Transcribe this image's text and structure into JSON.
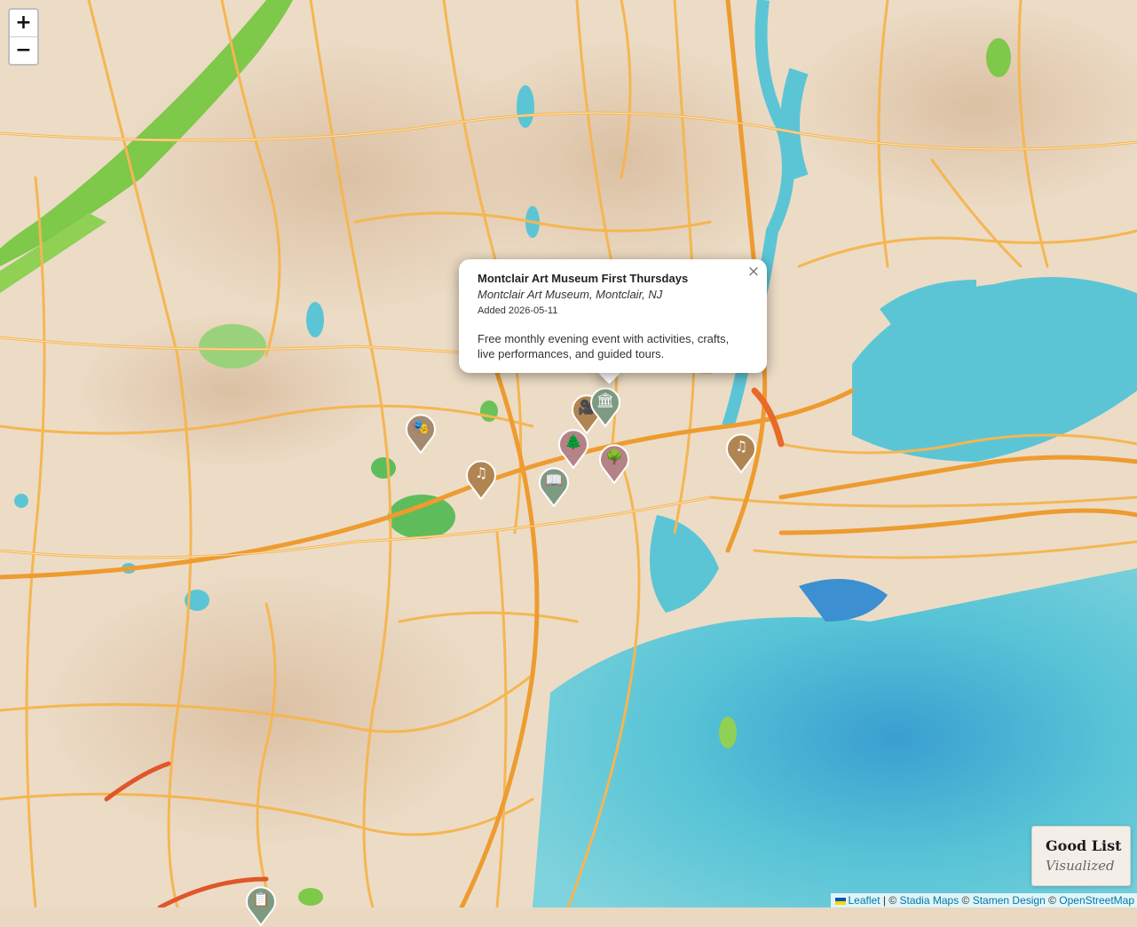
{
  "map": {
    "zoom_in_label": "+",
    "zoom_out_label": "−",
    "markers": [
      {
        "icon": "theater-masks-icon",
        "glyph": "🎭",
        "color": "#a48a6e"
      },
      {
        "icon": "music-note-icon",
        "glyph": "♫",
        "color": "#b08552"
      },
      {
        "icon": "book-icon",
        "glyph": "📖",
        "color": "#7f9a82"
      },
      {
        "icon": "tree-icon",
        "glyph": "🌲",
        "color": "#b48388"
      },
      {
        "icon": "video-camera-icon",
        "glyph": "🎥",
        "color": "#b08552"
      },
      {
        "icon": "museum-icon",
        "glyph": "🏛",
        "color": "#7f9a82"
      },
      {
        "icon": "tree-icon",
        "glyph": "🌳",
        "color": "#b48388"
      },
      {
        "icon": "music-note-icon",
        "glyph": "♫",
        "color": "#b08552"
      },
      {
        "icon": "calendar-icon",
        "glyph": "📋",
        "color": "#7f9a82"
      }
    ]
  },
  "popup": {
    "close_label": "×",
    "title": "Montclair Art Museum First Thursdays",
    "venue": "Montclair Art Museum, Montclair, NJ",
    "added": "Added 2026-05-11",
    "description": "Free monthly evening event with activities, crafts, live performances, and guided tours."
  },
  "brand": {
    "title": "Good List",
    "subtitle": "Visualized"
  },
  "attribution": {
    "leaflet": "Leaflet",
    "sep": " | © ",
    "stadia": "Stadia Maps",
    "copy1": " © ",
    "stamen": "Stamen Design",
    "copy2": " © ",
    "osm": "OpenStreetMap"
  },
  "colors": {
    "land": "#e9d8c2",
    "water": "#56c3d6",
    "park": "#7ec84a",
    "road": "#f2a93a",
    "highway": "#e86a28"
  }
}
